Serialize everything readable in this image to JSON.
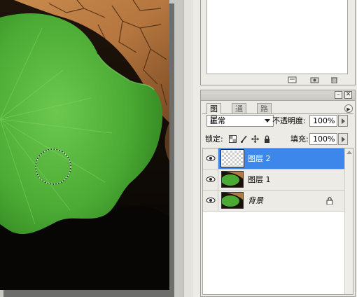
{
  "layers_panel": {
    "tabs": [
      {
        "label": "图层",
        "active": true
      },
      {
        "label": "通道",
        "active": false
      },
      {
        "label": "路径",
        "active": false
      }
    ],
    "blend_mode": "正常",
    "opacity_label": "不透明度:",
    "opacity_value": "100%",
    "lock_label": "锁定:",
    "fill_label": "填充:",
    "fill_value": "100%",
    "layers": [
      {
        "name": "图层 2",
        "selected": true,
        "visible": true,
        "thumbnail": "transparent"
      },
      {
        "name": "图层 1",
        "selected": false,
        "visible": true,
        "thumbnail": "lotus-leaf"
      },
      {
        "name": "背景",
        "selected": false,
        "visible": true,
        "thumbnail": "lotus-leaf",
        "locked": true
      }
    ]
  },
  "colors": {
    "selection_blue": "#3d86ea",
    "leaf_green": "#4fb43a",
    "panel_bg": "#ecebe6"
  },
  "icons": [
    "eye-icon",
    "lock-icon",
    "chain-icon",
    "brush-icon",
    "move-icon",
    "transparency-lock-icon",
    "trash-icon",
    "new-layer-icon",
    "snapshot-icon",
    "panel-menu-icon",
    "minimize-icon",
    "close-icon"
  ]
}
